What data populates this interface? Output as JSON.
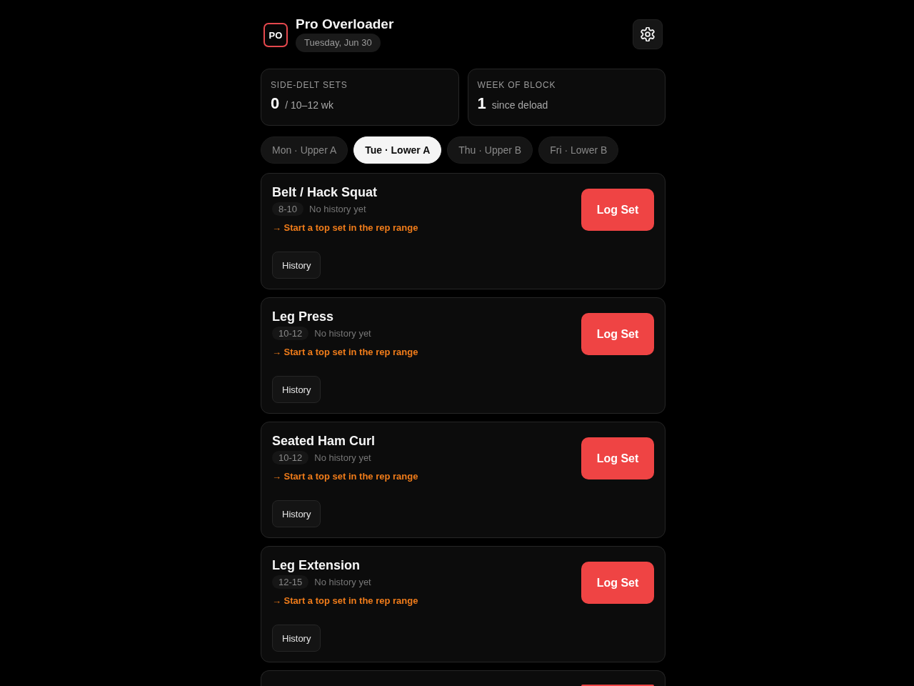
{
  "app": {
    "logo": "PO",
    "title": "Pro Overloader",
    "date": "Tuesday, Jun 30"
  },
  "stats": [
    {
      "label": "SIDE-DELT SETS",
      "value": "0",
      "detail": "/ 10–12 wk"
    },
    {
      "label": "WEEK OF BLOCK",
      "value": "1",
      "detail": "since deload"
    }
  ],
  "day_tabs": [
    {
      "label": "Mon · Upper A",
      "selected": false
    },
    {
      "label": "Tue · Lower A",
      "selected": true
    },
    {
      "label": "Thu · Upper B",
      "selected": false
    },
    {
      "label": "Fri · Lower B",
      "selected": false
    }
  ],
  "exercises": [
    {
      "kind": "card",
      "name": "Belt / Hack Squat",
      "rep_range": "8-10",
      "history_note": "No history yet",
      "hint": "→ Start a top set in the rep range",
      "history_button": "History",
      "log_button": "Log Set"
    },
    {
      "kind": "card",
      "name": "Leg Press",
      "rep_range": "10-12",
      "history_note": "No history yet",
      "hint": "→ Start a top set in the rep range",
      "history_button": "History",
      "log_button": "Log Set"
    },
    {
      "kind": "card",
      "name": "Seated Ham Curl",
      "rep_range": "10-12",
      "history_note": "No history yet",
      "hint": "→ Start a top set in the rep range",
      "history_button": "History",
      "log_button": "Log Set"
    },
    {
      "kind": "card",
      "name": "Leg Extension",
      "rep_range": "12-15",
      "history_note": "No history yet",
      "hint": "→ Start a top set in the rep range",
      "history_button": "History",
      "log_button": "Log Set"
    },
    {
      "kind": "clipped"
    }
  ]
}
